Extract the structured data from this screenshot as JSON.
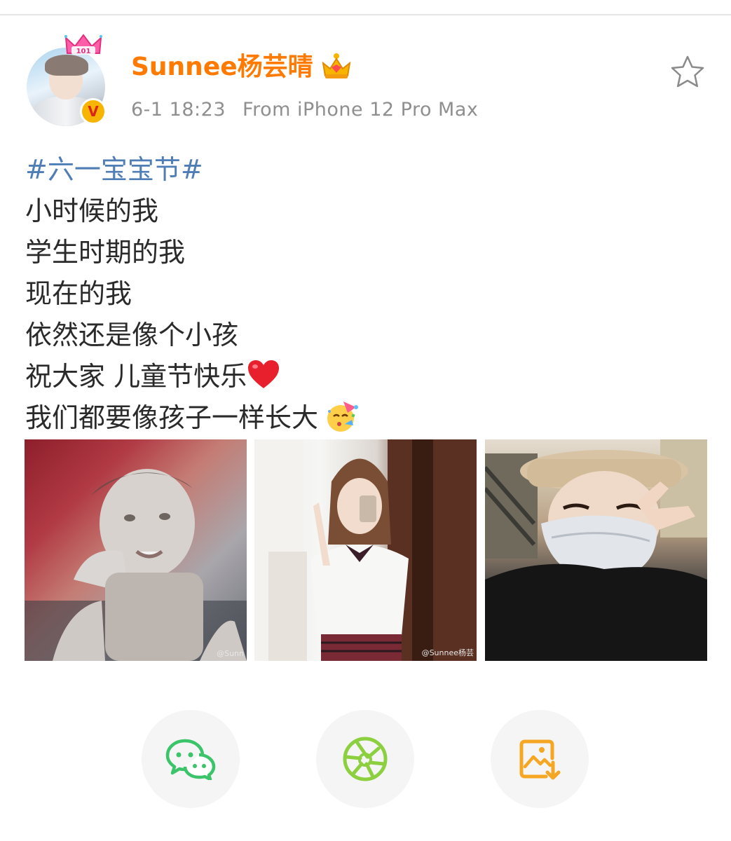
{
  "post": {
    "author": "Sunnee杨芸晴",
    "time": "6-1 18:23",
    "source": "From iPhone 12 Pro Max",
    "hashtag": "#六一宝宝节#",
    "lines": [
      "小时候的我",
      "学生时期的我",
      "现在的我",
      "依然还是像个小孩",
      "祝大家 儿童节快乐",
      "我们都要像孩子一样长大"
    ],
    "avatar_badge_text": "101",
    "verified_badge": "V",
    "photos": [
      {
        "watermark": "@Sunn"
      },
      {
        "watermark": "@Sunnee杨芸"
      },
      {
        "watermark": ""
      }
    ]
  },
  "share_actions": [
    {
      "icon": "wechat-icon",
      "color": "#3cc46a"
    },
    {
      "icon": "moments-icon",
      "color": "#8ccf3f"
    },
    {
      "icon": "save-image-icon",
      "color": "#f5a623"
    }
  ],
  "colors": {
    "username": "#ff7a00",
    "hashtag": "#4f7db5",
    "meta": "#8f8f8f",
    "body_text": "#2a2a2a"
  }
}
